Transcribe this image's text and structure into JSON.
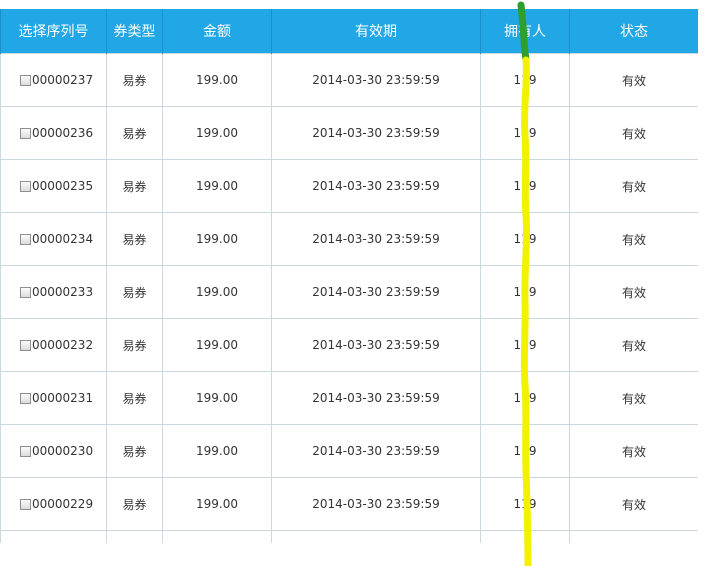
{
  "table": {
    "headers": [
      "选择序列号",
      "券类型",
      "金额",
      "有效期",
      "拥有人",
      "状态"
    ],
    "rows": [
      {
        "serial": "00000237",
        "type": "易券",
        "amount": "199.00",
        "expiry": "2014-03-30 23:59:59",
        "owner": "119",
        "status": "有效"
      },
      {
        "serial": "00000236",
        "type": "易券",
        "amount": "199.00",
        "expiry": "2014-03-30 23:59:59",
        "owner": "119",
        "status": "有效"
      },
      {
        "serial": "00000235",
        "type": "易券",
        "amount": "199.00",
        "expiry": "2014-03-30 23:59:59",
        "owner": "119",
        "status": "有效"
      },
      {
        "serial": "00000234",
        "type": "易券",
        "amount": "199.00",
        "expiry": "2014-03-30 23:59:59",
        "owner": "119",
        "status": "有效"
      },
      {
        "serial": "00000233",
        "type": "易券",
        "amount": "199.00",
        "expiry": "2014-03-30 23:59:59",
        "owner": "119",
        "status": "有效"
      },
      {
        "serial": "00000232",
        "type": "易券",
        "amount": "199.00",
        "expiry": "2014-03-30 23:59:59",
        "owner": "119",
        "status": "有效"
      },
      {
        "serial": "00000231",
        "type": "易券",
        "amount": "199.00",
        "expiry": "2014-03-30 23:59:59",
        "owner": "119",
        "status": "有效"
      },
      {
        "serial": "00000230",
        "type": "易券",
        "amount": "199.00",
        "expiry": "2014-03-30 23:59:59",
        "owner": "119",
        "status": "有效"
      },
      {
        "serial": "00000229",
        "type": "易券",
        "amount": "199.00",
        "expiry": "2014-03-30 23:59:59",
        "owner": "119",
        "status": "有效"
      },
      {
        "serial": "",
        "type": "",
        "amount": "",
        "expiry": "",
        "owner": "",
        "status": ""
      }
    ]
  },
  "colors": {
    "header_bg": "#22a7e6",
    "header_text": "#ffffff",
    "grid_line": "#c9d7e0",
    "marker_yellow": "#f2f200",
    "marker_green": "#2e9e2e"
  }
}
